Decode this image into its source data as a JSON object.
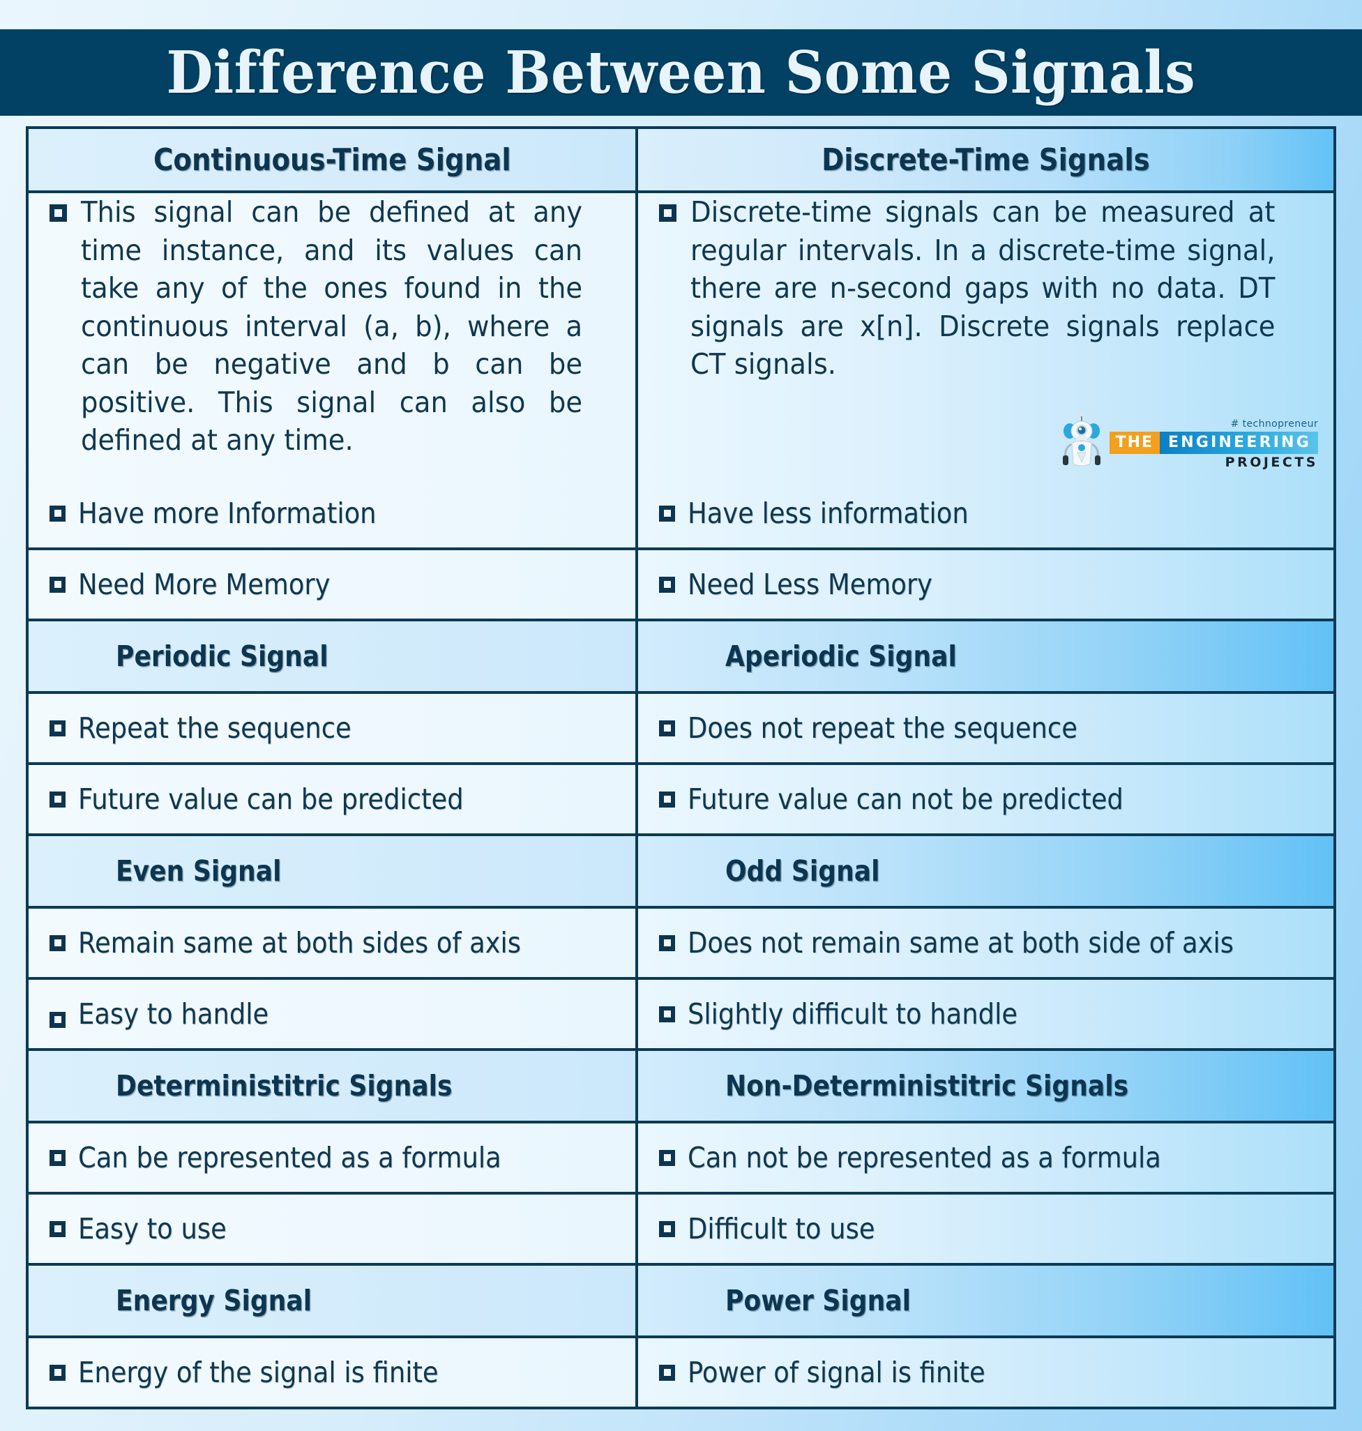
{
  "title": "Difference Between Some Signals",
  "table": {
    "headers": {
      "left": "Continuous-Time Signal",
      "right": "Discrete-Time Signals"
    },
    "intro": {
      "left": "This signal can be defined at any time instance, and its values can take any of the ones found in the continuous interval (a, b), where a can be negative and b can be positive. This signal can also be defined at any time.",
      "right": "Discrete-time signals can be measured at regular intervals. In a discrete-time signal, there are n-second gaps with no data. DT signals are x[n]. Discrete signals replace CT signals."
    },
    "rows": [
      {
        "type": "bullet",
        "left": "Have more Information",
        "right": "Have less information"
      },
      {
        "type": "bullet",
        "left": "Need More Memory",
        "right": "Need Less Memory"
      },
      {
        "type": "section",
        "left": "Periodic Signal",
        "right": "Aperiodic Signal"
      },
      {
        "type": "bullet",
        "left": "Repeat the sequence",
        "right": "Does not repeat the sequence"
      },
      {
        "type": "bullet",
        "left": "Future value can be predicted",
        "right": "Future value can not be predicted"
      },
      {
        "type": "section",
        "left": "Even Signal",
        "right": "Odd Signal"
      },
      {
        "type": "bullet",
        "left": "Remain same at both sides of axis",
        "right": "Does not remain same at both side of axis"
      },
      {
        "type": "bullet",
        "left": "Easy to handle",
        "right": "Slightly difficult to handle"
      },
      {
        "type": "section",
        "left": "Deterministitric Signals",
        "right": "Non-Deterministitric Signals"
      },
      {
        "type": "bullet",
        "left": "Can be represented as a formula",
        "right": "Can not be represented as a formula"
      },
      {
        "type": "bullet",
        "left": "Easy to use",
        "right": "Difficult to use"
      },
      {
        "type": "section",
        "left": "Energy Signal",
        "right": "Power Signal"
      },
      {
        "type": "bullet",
        "left": "Energy of the signal is finite",
        "right": "Power of signal is finite"
      }
    ]
  },
  "logo": {
    "tagline": "# technopreneur",
    "the": "THE",
    "engineering": "ENGINEERING",
    "projects": "PROJECTS"
  },
  "colors": {
    "title_bar": "#024164",
    "title_text": "#e8f4fb",
    "border": "#0b3a55",
    "body_text": "#10374f",
    "heading_text": "#0d3550",
    "logo_orange": "#f2a01e",
    "logo_blue": "#0b7fc4",
    "page_bg_light": "#eaf6fd",
    "page_bg_blue": "#9ad4f7"
  }
}
